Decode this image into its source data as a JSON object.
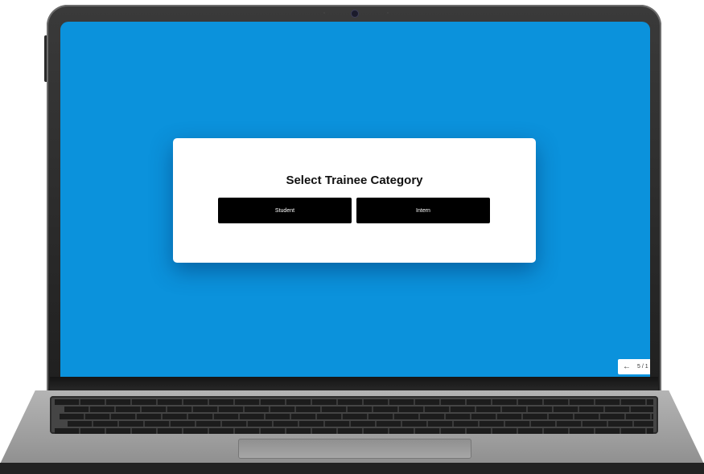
{
  "dialog": {
    "title": "Select Trainee Category",
    "options": [
      {
        "label": "Student"
      },
      {
        "label": "Intern"
      }
    ]
  },
  "pager": {
    "back_icon": "arrow-left-icon",
    "text": "5 / 1"
  },
  "colors": {
    "screen_background": "#0b92dc",
    "dialog_background": "#ffffff",
    "button_background": "#000000",
    "button_text": "#ffffff"
  }
}
